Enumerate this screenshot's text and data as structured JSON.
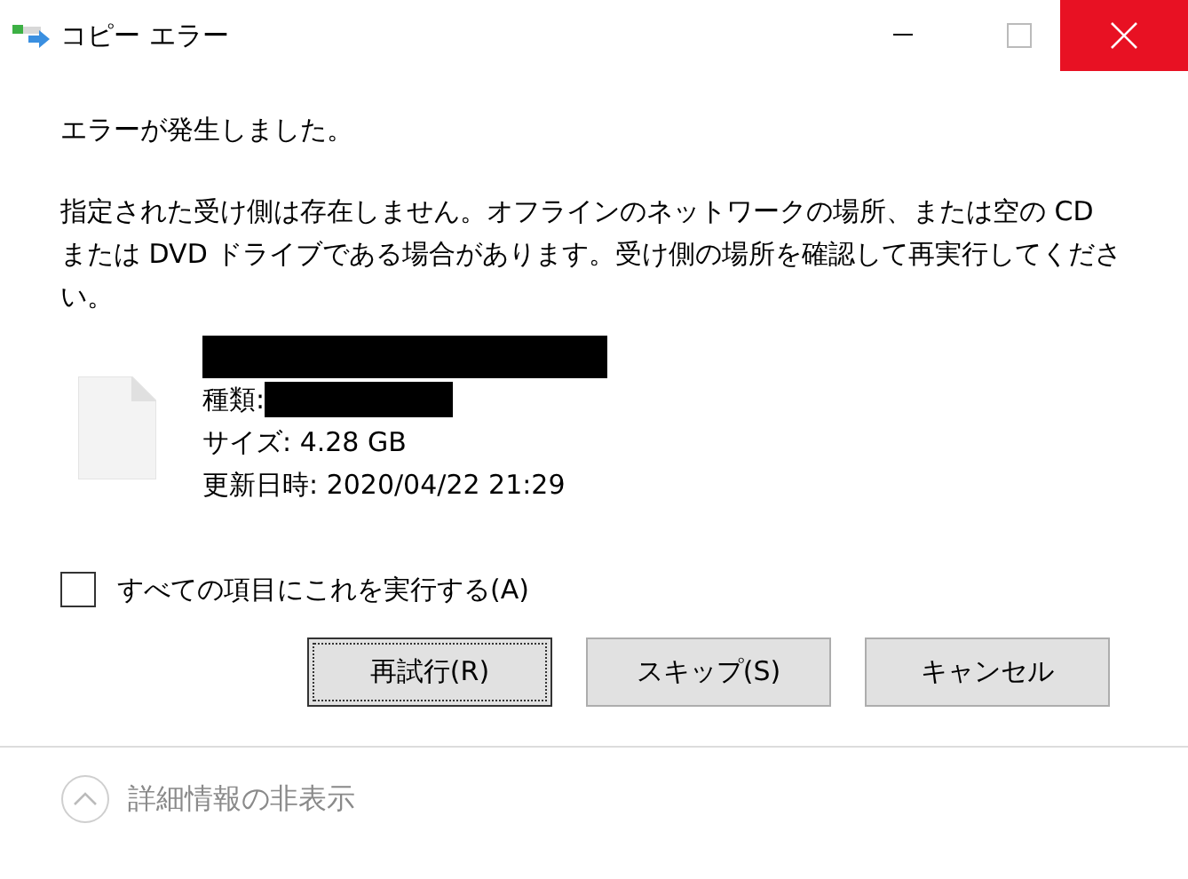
{
  "window": {
    "title": "コピー エラー"
  },
  "heading": "エラーが発生しました。",
  "message": "指定された受け側は存在しません。オフラインのネットワークの場所、または空の CD または DVD ドライブである場合があります。受け側の場所を確認して再実行してください。",
  "file": {
    "type_label": "種類:",
    "size": "サイズ: 4.28 GB",
    "modified": "更新日時: 2020/04/22 21:29"
  },
  "apply_all": {
    "label": "すべての項目にこれを実行する(A)",
    "checked": false
  },
  "buttons": [
    {
      "label": "再試行(R)",
      "focused": true
    },
    {
      "label": "スキップ(S)",
      "focused": false
    },
    {
      "label": "キャンセル",
      "focused": false
    }
  ],
  "details_toggle": {
    "label": "詳細情報の非表示",
    "expanded": true
  }
}
